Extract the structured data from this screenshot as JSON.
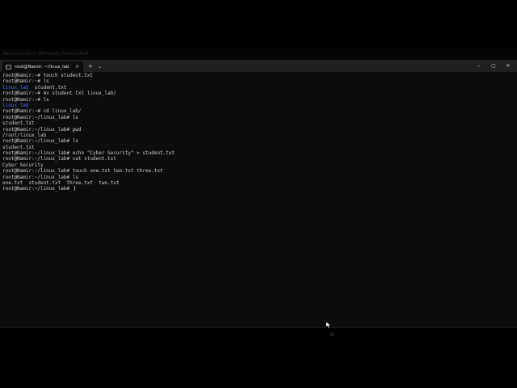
{
  "background_window": {
    "tab_label": "Administrator: Windows PowerShell"
  },
  "window": {
    "tab": {
      "icon": "terminal-icon",
      "label": "root@Namir: ~/linux_lab",
      "close": "×"
    },
    "new_tab": "+",
    "dropdown": "⌄",
    "controls": {
      "minimize": "–",
      "maximize": "▢",
      "close": "✕"
    }
  },
  "colors": {
    "terminal_bg": "#0c0c0c",
    "titlebar_bg": "#202020",
    "text": "#cccccc",
    "directory": "#3b78ff"
  },
  "console": {
    "lines": [
      [
        {
          "t": "root@Namir:~# touch student.txt",
          "c": ""
        }
      ],
      [
        {
          "t": "root@Namir:~# ls",
          "c": ""
        }
      ],
      [
        {
          "t": "linux_lab",
          "c": "dir"
        },
        {
          "t": "  student.txt",
          "c": ""
        }
      ],
      [
        {
          "t": "root@Namir:~# mv student.txt linux_lab/",
          "c": ""
        }
      ],
      [
        {
          "t": "root@Namir:~# ls",
          "c": ""
        }
      ],
      [
        {
          "t": "linux_lab",
          "c": "dir"
        }
      ],
      [
        {
          "t": "root@Namir:~# cd linux_lab/",
          "c": ""
        }
      ],
      [
        {
          "t": "root@Namir:~/linux_lab# ls",
          "c": ""
        }
      ],
      [
        {
          "t": "student.txt",
          "c": ""
        }
      ],
      [
        {
          "t": "root@Namir:~/linux_lab# pwd",
          "c": ""
        }
      ],
      [
        {
          "t": "/root/linux_lab",
          "c": ""
        }
      ],
      [
        {
          "t": "root@Namir:~/linux_lab# ls",
          "c": ""
        }
      ],
      [
        {
          "t": "student.txt",
          "c": ""
        }
      ],
      [
        {
          "t": "root@Namir:~/linux_lab# echo \"Cyber Security\" > student.txt",
          "c": ""
        }
      ],
      [
        {
          "t": "root@Namir:~/linux_lab# cat student.txt",
          "c": ""
        }
      ],
      [
        {
          "t": "Cyber Security",
          "c": ""
        }
      ],
      [
        {
          "t": "root@Namir:~/linux_lab# touch one.txt two.txt three.txt",
          "c": ""
        }
      ],
      [
        {
          "t": "root@Namir:~/linux_lab# ls",
          "c": ""
        }
      ],
      [
        {
          "t": "one.txt  student.txt  three.txt  two.txt",
          "c": ""
        }
      ],
      [
        {
          "t": "root@Namir:~/linux_lab# ",
          "c": ""
        }
      ]
    ]
  }
}
